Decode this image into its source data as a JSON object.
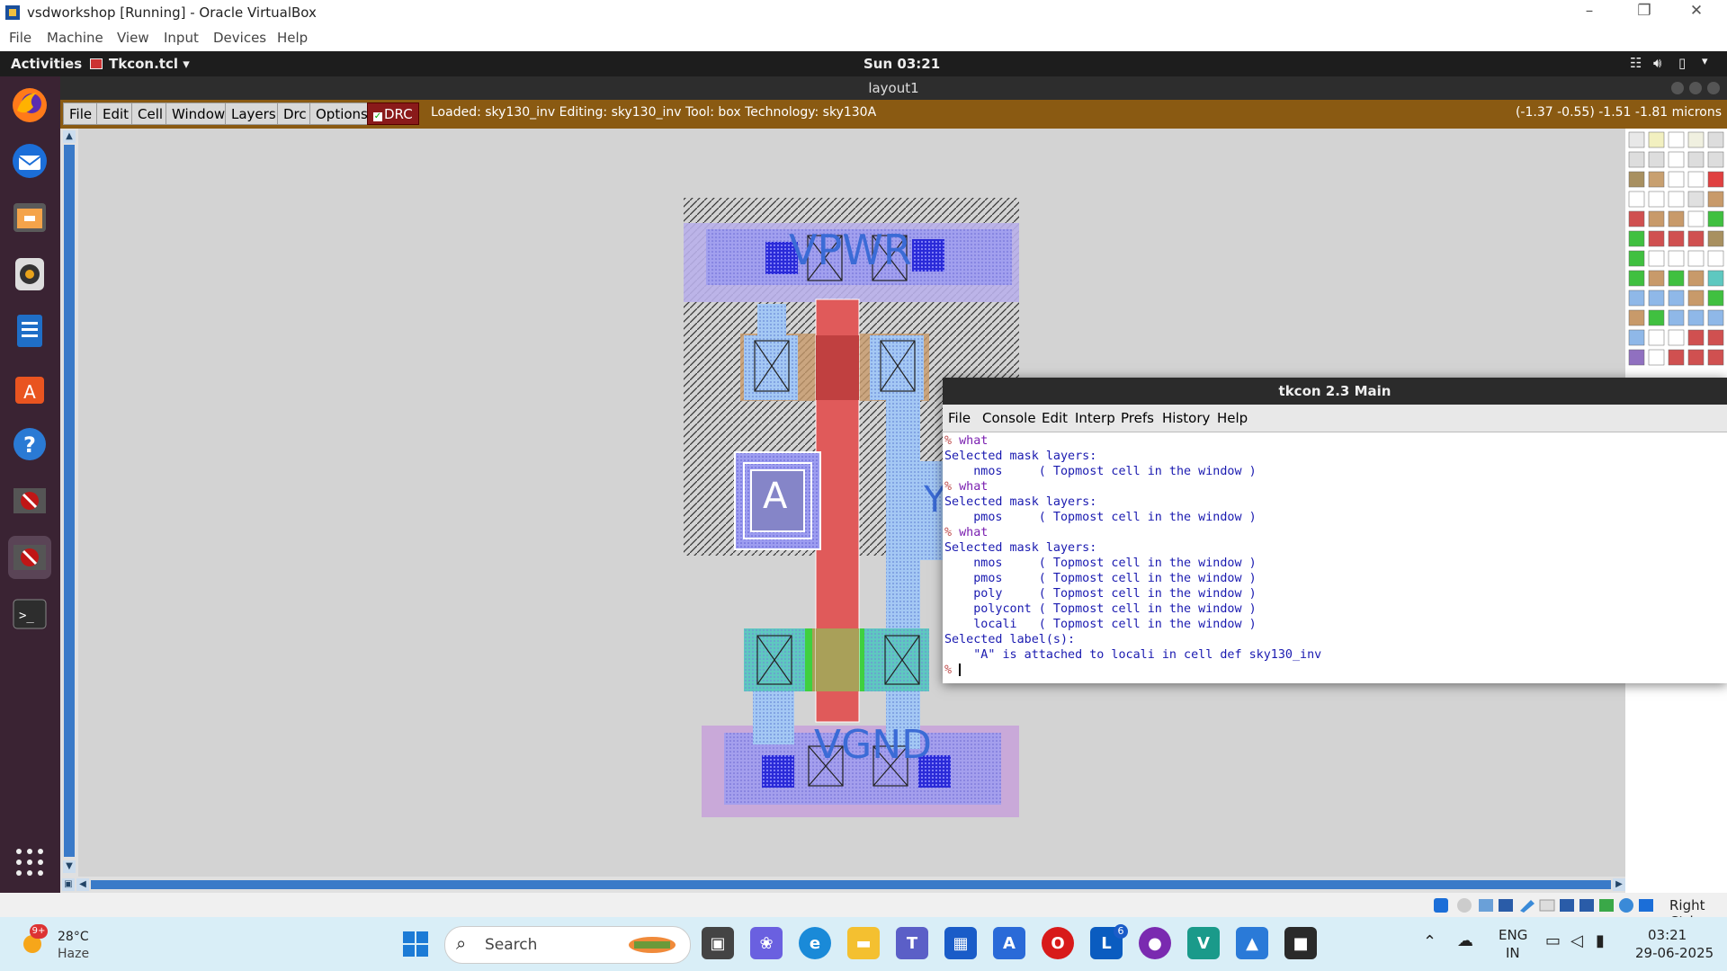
{
  "vbox": {
    "title": "vsdworkshop [Running] - Oracle VirtualBox",
    "menu": [
      "File",
      "Machine",
      "View",
      "Input",
      "Devices",
      "Help"
    ],
    "host_key": "Right Ctrl"
  },
  "gnome": {
    "activities": "Activities",
    "app_menu": "Tkcon.tcl",
    "clock": "Sun 03:21"
  },
  "dock_items": [
    "firefox-icon",
    "thunderbird-icon",
    "files-icon",
    "rhythmbox-icon",
    "writer-icon",
    "software-icon",
    "help-icon",
    "magic-icon",
    "magic-icon-2",
    "terminal-icon",
    "app-grid-icon"
  ],
  "magic": {
    "window_title": "layout1",
    "menu": [
      "File",
      "Edit",
      "Cell",
      "Window",
      "Layers",
      "Drc",
      "Options"
    ],
    "drc_label": "DRC",
    "status": "Loaded: sky130_inv Editing: sky130_inv Tool: box  Technology: sky130A",
    "coords": "(-1.37 -0.55) -1.51 -1.81 microns",
    "labels": {
      "vpwr": "VPWR",
      "vgnd": "VGND",
      "a": "A",
      "y": "Y"
    },
    "colors": {
      "toolbar": "#8a5a12",
      "canvas": "#d3d3d3",
      "poly": "#e05a5a",
      "locali": "#8f8fe8",
      "nwell": "#9b6fb3"
    }
  },
  "tkcon": {
    "title": "tkcon 2.3 Main",
    "menu": [
      "File",
      "Console",
      "Edit",
      "Interp",
      "Prefs",
      "History",
      "Help"
    ],
    "lines": [
      {
        "p": "% ",
        "t": "what",
        "type": "cmd"
      },
      {
        "p": "",
        "t": "Selected mask layers:",
        "type": "out"
      },
      {
        "p": "",
        "t": "    nmos     ( Topmost cell in the window )",
        "type": "out"
      },
      {
        "p": "% ",
        "t": "what",
        "type": "cmd"
      },
      {
        "p": "",
        "t": "Selected mask layers:",
        "type": "out"
      },
      {
        "p": "",
        "t": "    pmos     ( Topmost cell in the window )",
        "type": "out"
      },
      {
        "p": "% ",
        "t": "what",
        "type": "cmd"
      },
      {
        "p": "",
        "t": "Selected mask layers:",
        "type": "out"
      },
      {
        "p": "",
        "t": "    nmos     ( Topmost cell in the window )",
        "type": "out"
      },
      {
        "p": "",
        "t": "    pmos     ( Topmost cell in the window )",
        "type": "out"
      },
      {
        "p": "",
        "t": "    poly     ( Topmost cell in the window )",
        "type": "out"
      },
      {
        "p": "",
        "t": "    polycont ( Topmost cell in the window )",
        "type": "out"
      },
      {
        "p": "",
        "t": "    locali   ( Topmost cell in the window )",
        "type": "out"
      },
      {
        "p": "",
        "t": "Selected label(s):",
        "type": "out"
      },
      {
        "p": "",
        "t": "    \"A\" is attached to locali in cell def sky130_inv",
        "type": "out"
      },
      {
        "p": "% ",
        "t": "",
        "type": "cmd"
      }
    ]
  },
  "taskbar": {
    "weather_temp": "28°C",
    "weather_desc": "Haze",
    "weather_badge": "9+",
    "search_placeholder": "Search",
    "lang_top": "ENG",
    "lang_bottom": "IN",
    "time": "03:21",
    "date": "29-06-2025",
    "outlook_badge": "6"
  }
}
